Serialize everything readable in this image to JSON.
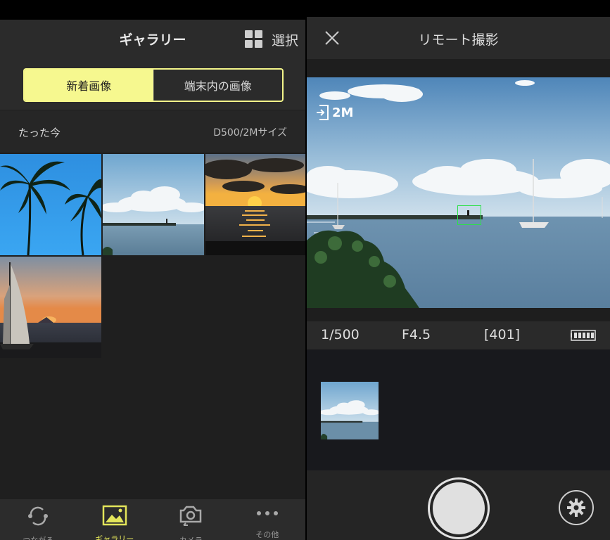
{
  "gallery": {
    "title": "ギャラリー",
    "select_label": "選択",
    "segments": {
      "new_images": "新着画像",
      "device_images": "端末内の画像"
    },
    "section": {
      "time_label": "たった今",
      "size_label": "D500/2Mサイズ"
    },
    "thumbnails": [
      {
        "name": "palm-trees"
      },
      {
        "name": "sea-clouds"
      },
      {
        "name": "sunset-clouds"
      },
      {
        "name": "sailboat-sunset"
      }
    ],
    "tabs": [
      {
        "label": "つながる",
        "icon": "connect-icon",
        "active": false
      },
      {
        "label": "ギャラリー",
        "icon": "gallery-icon",
        "active": true
      },
      {
        "label": "カメラ",
        "icon": "camera-icon",
        "active": false
      },
      {
        "label": "その他",
        "icon": "more-icon",
        "active": false
      }
    ]
  },
  "remote": {
    "title": "リモート撮影",
    "image_size_badge": "2M",
    "shutter_speed": "1/500",
    "aperture": "F4.5",
    "shots_remaining": "[401]",
    "battery_level": 1.0
  },
  "colors": {
    "accent_yellow": "#f6f88f",
    "active_tab_yellow": "#e3e55a",
    "af_green": "#2ee04a"
  }
}
